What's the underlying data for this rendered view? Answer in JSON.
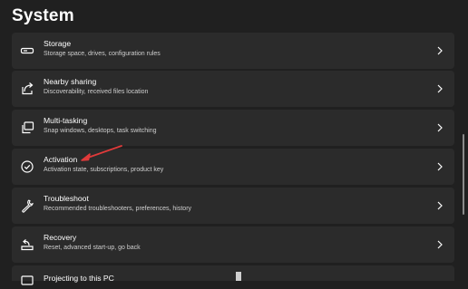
{
  "page": {
    "title": "System"
  },
  "items": [
    {
      "title": "Storage",
      "subtitle": "Storage space, drives, configuration rules",
      "icon": "storage-icon"
    },
    {
      "title": "Nearby sharing",
      "subtitle": "Discoverability, received files location",
      "icon": "share-icon"
    },
    {
      "title": "Multi-tasking",
      "subtitle": "Snap windows, desktops, task switching",
      "icon": "multitasking-icon"
    },
    {
      "title": "Activation",
      "subtitle": "Activation state, subscriptions, product key",
      "icon": "check-circle-icon"
    },
    {
      "title": "Troubleshoot",
      "subtitle": "Recommended troubleshooters, preferences, history",
      "icon": "wrench-icon"
    },
    {
      "title": "Recovery",
      "subtitle": "Reset, advanced start-up, go back",
      "icon": "recovery-icon"
    },
    {
      "title": "Projecting to this PC",
      "subtitle": "",
      "icon": "projection-icon"
    }
  ],
  "colors": {
    "background": "#202020",
    "card": "#2b2b2b",
    "annotation": "#e03a3a"
  }
}
